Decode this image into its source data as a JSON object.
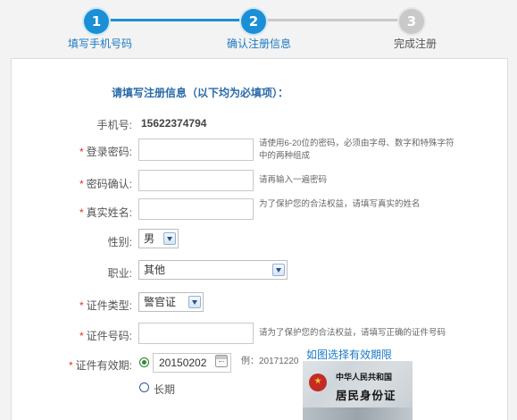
{
  "steps": [
    {
      "number": "1",
      "label": "填写手机号码"
    },
    {
      "number": "2",
      "label": "确认注册信息"
    },
    {
      "number": "3",
      "label": "完成注册"
    }
  ],
  "colors": {
    "accent": "#1b8fd6",
    "required": "#e0322b",
    "link": "#1b79c4",
    "heading": "#2a6aa8"
  },
  "form": {
    "heading": "请填写注册信息（以下均为必填项）：",
    "required_mark": "*",
    "phone": {
      "label": "手机号:",
      "value": "15622374794"
    },
    "password": {
      "label": "登录密码:",
      "hint_line1": "请使用6-20位的密码，必须由字母、数字和特殊字符",
      "hint_line2": "中的两种组成"
    },
    "confirm": {
      "label": "密码确认:",
      "hint": "请再输入一遍密码"
    },
    "realname": {
      "label": "真实姓名:",
      "hint": "为了保护您的合法权益，请填写真实的姓名"
    },
    "gender": {
      "label": "性别:",
      "value": "男"
    },
    "job": {
      "label": "职业:",
      "value": "其他"
    },
    "id_type": {
      "label": "证件类型:",
      "value": "警官证"
    },
    "id_number": {
      "label": "证件号码:",
      "hint": "请为了保护您的合法权益，请填写正确的证件号码"
    },
    "validity": {
      "label": "证件有效期:",
      "date_value": "20150202",
      "example": "例：20171220",
      "longterm_label": "长期",
      "link": "如图选择有效期限",
      "card_title_line1": "中华人民共和国",
      "card_title_line2": "居民身份证"
    }
  },
  "icons": {
    "date_picker": "calendar-icon",
    "select_arrow": "chevron-down-icon"
  }
}
